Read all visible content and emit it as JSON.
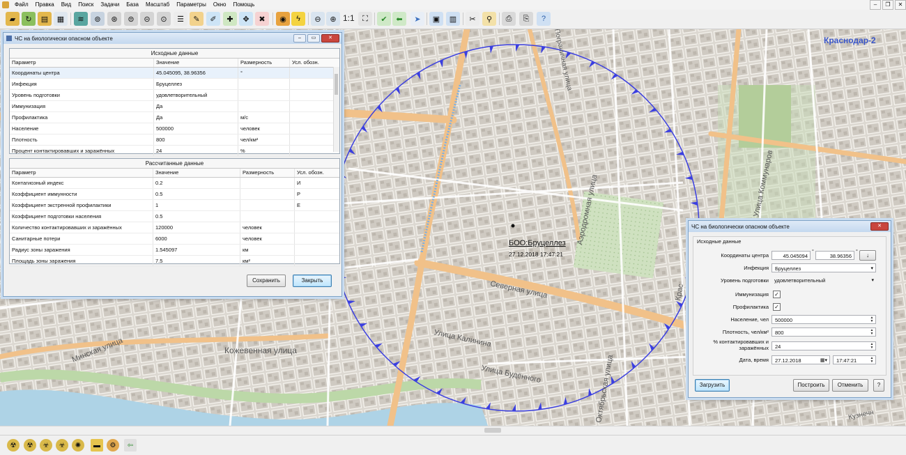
{
  "menu": {
    "items": [
      "Файл",
      "Правка",
      "Вид",
      "Поиск",
      "Задачи",
      "База",
      "Масштаб",
      "Параметры",
      "Окно",
      "Помощь"
    ]
  },
  "toolbar": {
    "zoom_ratio": "1:1"
  },
  "map": {
    "station_label": "Краснодар-2",
    "object_label": "БОО:Бруцеллез",
    "object_datetime": "27.12.2018 17:47:21",
    "streets": [
      "Северная улица",
      "Улица Калинина",
      "Улица Будённого",
      "Кожевенная улица",
      "Минская улица",
      "Аэродромная улица",
      "Улица Коммунаров",
      "Октябрьская улица",
      "Кузнечн",
      "Пограничная улица",
      "Крас"
    ]
  },
  "dialog1": {
    "title": "ЧС на биологически опасном объекте",
    "source_header": "Исходные данные",
    "columns": [
      "Параметр",
      "Значение",
      "Размерность",
      "Усл. обозн."
    ],
    "source_rows": [
      [
        "Координаты центра",
        "45.045095, 38.96356",
        "°",
        ""
      ],
      [
        "Инфекция",
        "Бруцеллез",
        "",
        ""
      ],
      [
        "Уровень подготовки",
        "удовлетворительный",
        "",
        ""
      ],
      [
        "Иммунизация",
        "Да",
        "",
        ""
      ],
      [
        "Профилактика",
        "Да",
        "м/с",
        ""
      ],
      [
        "Население",
        "500000",
        "человек",
        ""
      ],
      [
        "Плотность",
        "800",
        "чел/км²",
        ""
      ],
      [
        "Процент контактировавших и заражённых",
        "24",
        "%",
        ""
      ]
    ],
    "calc_header": "Рассчитанные данные",
    "calc_rows": [
      [
        "Контагиозный индекс",
        "0.2",
        "",
        "И"
      ],
      [
        "Коэффициент иммунности",
        "0.5",
        "",
        "Р"
      ],
      [
        "Коэффициент экстренной профилактики",
        "1",
        "",
        "Е"
      ],
      [
        "Коэффициент подготовки населения",
        "0.5",
        "",
        ""
      ],
      [
        "Количество контактировавших и заражённых",
        "120000",
        "человек",
        ""
      ],
      [
        "Санитарные потери",
        "6000",
        "человек",
        ""
      ],
      [
        "Радиус зоны заражения",
        "1.545097",
        "км",
        ""
      ],
      [
        "Площадь зоны заражения",
        "7.5",
        "км²",
        ""
      ]
    ],
    "save_label": "Сохранить",
    "close_label": "Закрыть"
  },
  "dialog2": {
    "title": "ЧС на биологически опасном объекте",
    "group_label": "Исходные данные",
    "coord_label": "Координаты центра",
    "lat": "45.045094",
    "lon": "38.96356",
    "deg": "°",
    "arrow": "↓",
    "infection_label": "Инфекция",
    "infection_value": "Бруцеллез",
    "training_label": "Уровень подготовки",
    "training_value": "удовлетворительный",
    "immun_label": "Иммунизация",
    "prof_label": "Профилактика",
    "population_label": "Население, чел",
    "population_value": "500000",
    "density_label": "Плотность, чел/км²",
    "density_value": "800",
    "percent_label": "% контактировавших и заражённых",
    "percent_value": "24",
    "datetime_label": "Дата, время",
    "date_value": "27.12.2018",
    "time_value": "17:47:21",
    "load_label": "Загрузить",
    "build_label": "Построить",
    "cancel_label": "Отменить",
    "help_label": "?"
  }
}
